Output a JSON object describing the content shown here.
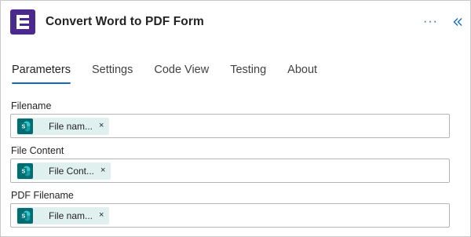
{
  "header": {
    "title": "Convert Word to PDF Form",
    "more_label": "···"
  },
  "tabs": [
    {
      "label": "Parameters",
      "active": true
    },
    {
      "label": "Settings"
    },
    {
      "label": "Code View"
    },
    {
      "label": "Testing"
    },
    {
      "label": "About"
    }
  ],
  "fields": [
    {
      "label": "Filename",
      "token": {
        "icon": "sharepoint-icon",
        "text": "File nam...",
        "remove": "×"
      }
    },
    {
      "label": "File Content",
      "token": {
        "icon": "sharepoint-icon",
        "text": "File Cont...",
        "remove": "×"
      }
    },
    {
      "label": "PDF Filename",
      "token": {
        "icon": "sharepoint-icon",
        "text": "File nam...",
        "remove": "×"
      }
    }
  ],
  "colors": {
    "accent": "#0f6cbd",
    "app_icon": "#4a2a8f",
    "token_bg": "#dff0ef",
    "sharepoint": "#036c70"
  }
}
